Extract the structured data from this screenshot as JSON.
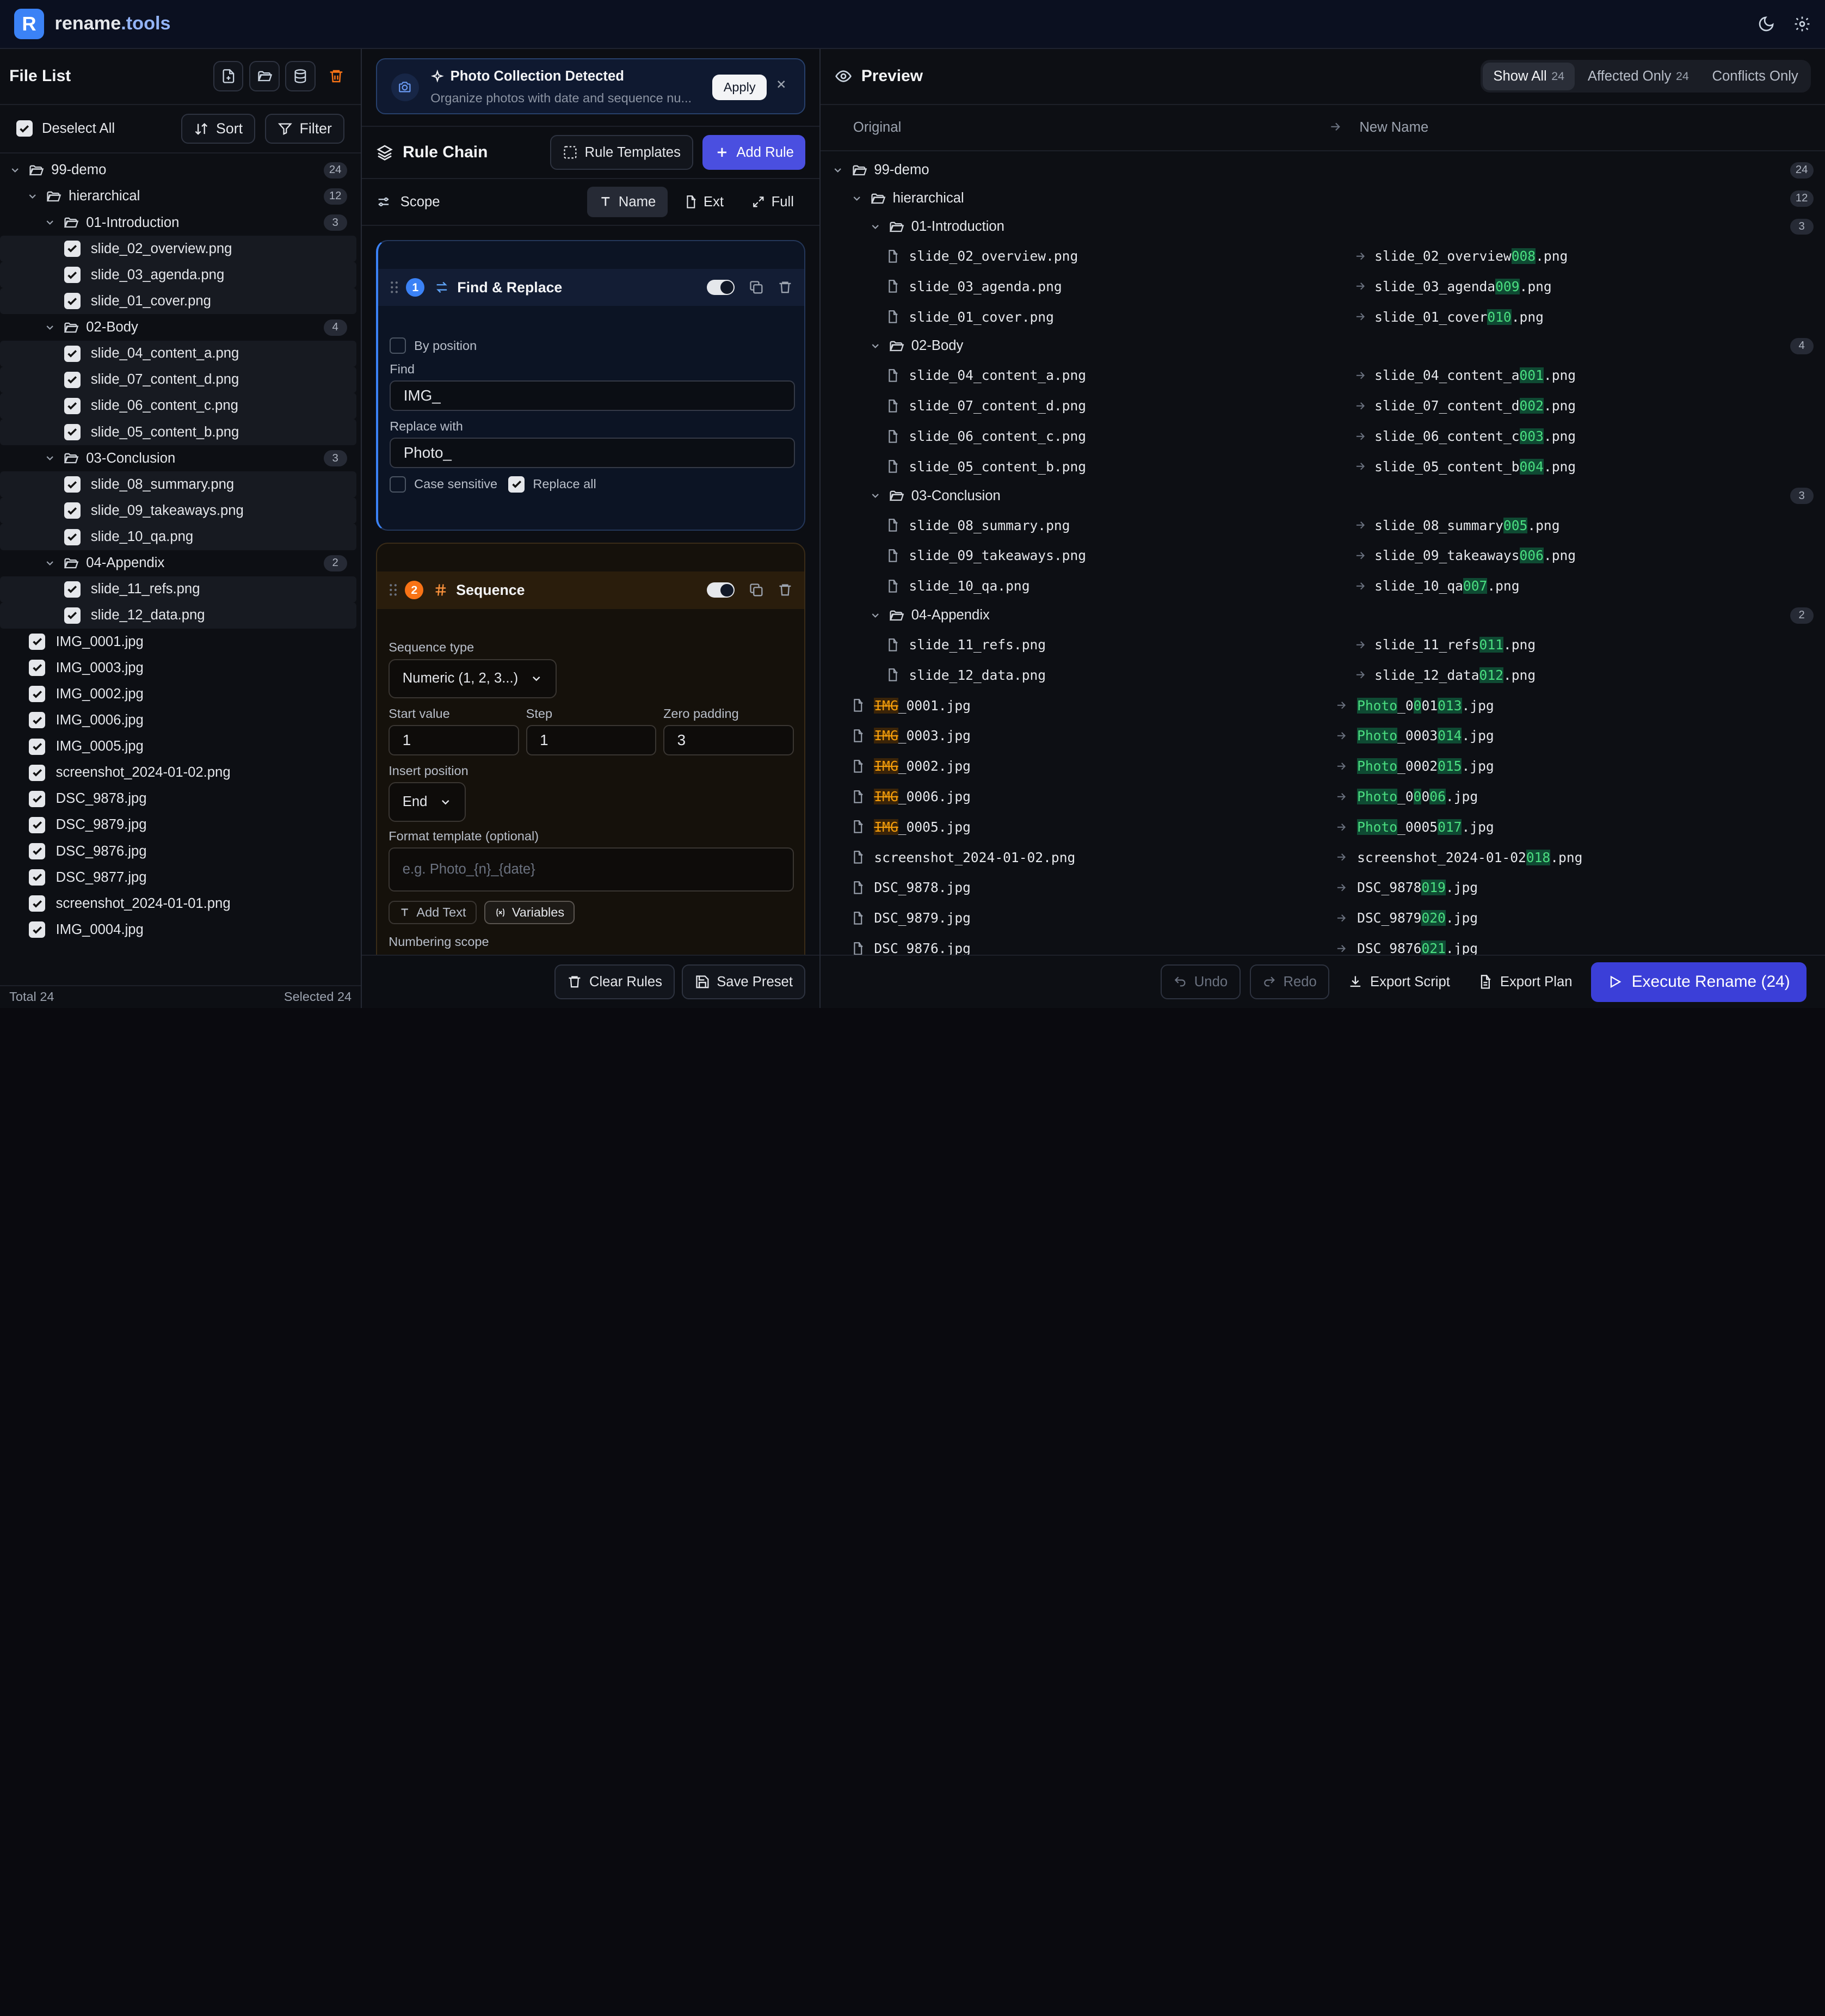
{
  "app": {
    "name": "rename",
    "tld": ".tools",
    "logo_letter": "R"
  },
  "colors": {
    "accent": "#4a4fe0",
    "highlight_add": "#4ade80",
    "highlight_remove": "#f59e0b",
    "danger": "#f97316"
  },
  "file_list": {
    "title": "File List",
    "deselect_label": "Deselect All",
    "sort_label": "Sort",
    "filter_label": "Filter",
    "footer_total": "Total 24",
    "footer_selected": "Selected 24",
    "tree": [
      {
        "kind": "dir",
        "depth": 0,
        "name": "99-demo",
        "count": "24"
      },
      {
        "kind": "dir",
        "depth": 1,
        "name": "hierarchical",
        "count": "12"
      },
      {
        "kind": "dir",
        "depth": 2,
        "name": "01-Introduction",
        "count": "3"
      },
      {
        "kind": "file",
        "depth": 3,
        "name": "slide_02_overview.png"
      },
      {
        "kind": "file",
        "depth": 3,
        "name": "slide_03_agenda.png"
      },
      {
        "kind": "file",
        "depth": 3,
        "name": "slide_01_cover.png"
      },
      {
        "kind": "dir",
        "depth": 2,
        "name": "02-Body",
        "count": "4"
      },
      {
        "kind": "file",
        "depth": 3,
        "name": "slide_04_content_a.png"
      },
      {
        "kind": "file",
        "depth": 3,
        "name": "slide_07_content_d.png"
      },
      {
        "kind": "file",
        "depth": 3,
        "name": "slide_06_content_c.png"
      },
      {
        "kind": "file",
        "depth": 3,
        "name": "slide_05_content_b.png"
      },
      {
        "kind": "dir",
        "depth": 2,
        "name": "03-Conclusion",
        "count": "3"
      },
      {
        "kind": "file",
        "depth": 3,
        "name": "slide_08_summary.png"
      },
      {
        "kind": "file",
        "depth": 3,
        "name": "slide_09_takeaways.png"
      },
      {
        "kind": "file",
        "depth": 3,
        "name": "slide_10_qa.png"
      },
      {
        "kind": "dir",
        "depth": 2,
        "name": "04-Appendix",
        "count": "2"
      },
      {
        "kind": "file",
        "depth": 3,
        "name": "slide_11_refs.png"
      },
      {
        "kind": "file",
        "depth": 3,
        "name": "slide_12_data.png"
      },
      {
        "kind": "file",
        "depth": 1,
        "name": "IMG_0001.jpg"
      },
      {
        "kind": "file",
        "depth": 1,
        "name": "IMG_0003.jpg"
      },
      {
        "kind": "file",
        "depth": 1,
        "name": "IMG_0002.jpg"
      },
      {
        "kind": "file",
        "depth": 1,
        "name": "IMG_0006.jpg"
      },
      {
        "kind": "file",
        "depth": 1,
        "name": "IMG_0005.jpg"
      },
      {
        "kind": "file",
        "depth": 1,
        "name": "screenshot_2024-01-02.png"
      },
      {
        "kind": "file",
        "depth": 1,
        "name": "DSC_9878.jpg"
      },
      {
        "kind": "file",
        "depth": 1,
        "name": "DSC_9879.jpg"
      },
      {
        "kind": "file",
        "depth": 1,
        "name": "DSC_9876.jpg"
      },
      {
        "kind": "file",
        "depth": 1,
        "name": "DSC_9877.jpg"
      },
      {
        "kind": "file",
        "depth": 1,
        "name": "screenshot_2024-01-01.png"
      },
      {
        "kind": "file",
        "depth": 1,
        "name": "IMG_0004.jpg"
      }
    ]
  },
  "banner": {
    "title": "Photo Collection Detected",
    "description": "Organize photos with date and sequence nu...",
    "apply_label": "Apply"
  },
  "rule_chain": {
    "title": "Rule Chain",
    "templates_label": "Rule Templates",
    "add_label": "Add Rule",
    "scope_label": "Scope",
    "scope_options": [
      "Name",
      "Ext",
      "Full"
    ],
    "rule1": {
      "number": "1",
      "name": "Find & Replace",
      "by_position_label": "By position",
      "find_label": "Find",
      "find_value": "IMG_",
      "replace_label": "Replace with",
      "replace_value": "Photo_",
      "case_label": "Case sensitive",
      "replace_all_label": "Replace all"
    },
    "rule2": {
      "number": "2",
      "name": "Sequence",
      "seq_type_label": "Sequence type",
      "seq_type_value": "Numeric (1, 2, 3...)",
      "start_label": "Start value",
      "start_value": "1",
      "step_label": "Step",
      "step_value": "1",
      "pad_label": "Zero padding",
      "pad_value": "3",
      "insert_label": "Insert position",
      "insert_value": "End",
      "format_label": "Format template (optional)",
      "format_placeholder": "e.g. Photo_{n}_{date}",
      "add_text_label": "Add Text",
      "variables_label": "Variables",
      "numbering_label": "Numbering scope"
    },
    "clear_label": "Clear Rules",
    "save_label": "Save Preset"
  },
  "preview": {
    "title": "Preview",
    "tabs": [
      {
        "label": "Show All",
        "count": "24"
      },
      {
        "label": "Affected Only",
        "count": "24"
      },
      {
        "label": "Conflicts Only",
        "count": ""
      }
    ],
    "col_original": "Original",
    "col_new": "New Name",
    "undo_label": "Undo",
    "redo_label": "Redo",
    "export_script_label": "Export Script",
    "export_plan_label": "Export Plan",
    "execute_label": "Execute Rename (24)",
    "rows": [
      {
        "kind": "dir",
        "depth": 0,
        "name": "99-demo",
        "count": "24"
      },
      {
        "kind": "dir",
        "depth": 1,
        "name": "hierarchical",
        "count": "12"
      },
      {
        "kind": "dir",
        "depth": 2,
        "name": "01-Introduction",
        "count": "3"
      },
      {
        "kind": "file",
        "depth": 3,
        "orig": [
          [
            "slide_02_overview.png",
            ""
          ]
        ],
        "new": [
          [
            "slide_02_overview",
            ""
          ],
          [
            "008",
            "a"
          ],
          [
            ".png",
            ""
          ]
        ]
      },
      {
        "kind": "file",
        "depth": 3,
        "orig": [
          [
            "slide_03_agenda.png",
            ""
          ]
        ],
        "new": [
          [
            "slide_03_agenda",
            ""
          ],
          [
            "009",
            "a"
          ],
          [
            ".png",
            ""
          ]
        ]
      },
      {
        "kind": "file",
        "depth": 3,
        "orig": [
          [
            "slide_01_cover.png",
            ""
          ]
        ],
        "new": [
          [
            "slide_01_cover",
            ""
          ],
          [
            "010",
            "a"
          ],
          [
            ".png",
            ""
          ]
        ]
      },
      {
        "kind": "dir",
        "depth": 2,
        "name": "02-Body",
        "count": "4"
      },
      {
        "kind": "file",
        "depth": 3,
        "orig": [
          [
            "slide_04_content_a.png",
            ""
          ]
        ],
        "new": [
          [
            "slide_04_content_a",
            ""
          ],
          [
            "001",
            "a"
          ],
          [
            ".png",
            ""
          ]
        ]
      },
      {
        "kind": "file",
        "depth": 3,
        "orig": [
          [
            "slide_07_content_d.png",
            ""
          ]
        ],
        "new": [
          [
            "slide_07_content_d",
            ""
          ],
          [
            "002",
            "a"
          ],
          [
            ".png",
            ""
          ]
        ]
      },
      {
        "kind": "file",
        "depth": 3,
        "orig": [
          [
            "slide_06_content_c.png",
            ""
          ]
        ],
        "new": [
          [
            "slide_06_content_c",
            ""
          ],
          [
            "003",
            "a"
          ],
          [
            ".png",
            ""
          ]
        ]
      },
      {
        "kind": "file",
        "depth": 3,
        "orig": [
          [
            "slide_05_content_b.png",
            ""
          ]
        ],
        "new": [
          [
            "slide_05_content_b",
            ""
          ],
          [
            "004",
            "a"
          ],
          [
            ".png",
            ""
          ]
        ]
      },
      {
        "kind": "dir",
        "depth": 2,
        "name": "03-Conclusion",
        "count": "3"
      },
      {
        "kind": "file",
        "depth": 3,
        "orig": [
          [
            "slide_08_summary.png",
            ""
          ]
        ],
        "new": [
          [
            "slide_08_summary",
            ""
          ],
          [
            "005",
            "a"
          ],
          [
            ".png",
            ""
          ]
        ]
      },
      {
        "kind": "file",
        "depth": 3,
        "orig": [
          [
            "slide_09_takeaways.png",
            ""
          ]
        ],
        "new": [
          [
            "slide_09_takeaways",
            ""
          ],
          [
            "006",
            "a"
          ],
          [
            ".png",
            ""
          ]
        ]
      },
      {
        "kind": "file",
        "depth": 3,
        "orig": [
          [
            "slide_10_qa.png",
            ""
          ]
        ],
        "new": [
          [
            "slide_10_qa",
            ""
          ],
          [
            "007",
            "a"
          ],
          [
            ".png",
            ""
          ]
        ]
      },
      {
        "kind": "dir",
        "depth": 2,
        "name": "04-Appendix",
        "count": "2"
      },
      {
        "kind": "file",
        "depth": 3,
        "orig": [
          [
            "slide_11_refs.png",
            ""
          ]
        ],
        "new": [
          [
            "slide_11_refs",
            ""
          ],
          [
            "011",
            "a"
          ],
          [
            ".png",
            ""
          ]
        ]
      },
      {
        "kind": "file",
        "depth": 3,
        "orig": [
          [
            "slide_12_data.png",
            ""
          ]
        ],
        "new": [
          [
            "slide_12_data",
            ""
          ],
          [
            "012",
            "a"
          ],
          [
            ".png",
            ""
          ]
        ]
      },
      {
        "kind": "file",
        "depth": 1,
        "orig": [
          [
            "IMG",
            "d"
          ],
          [
            "_0001.jpg",
            ""
          ]
        ],
        "new": [
          [
            "Photo",
            "a"
          ],
          [
            "_0",
            ""
          ],
          [
            "0",
            "a"
          ],
          [
            "01",
            ""
          ],
          [
            "01",
            "a"
          ],
          [
            "3",
            "a"
          ],
          [
            ".jpg",
            ""
          ]
        ]
      },
      {
        "kind": "file",
        "depth": 1,
        "orig": [
          [
            "IMG",
            "d"
          ],
          [
            "_0003.jpg",
            ""
          ]
        ],
        "new": [
          [
            "Photo",
            "a"
          ],
          [
            "_0003",
            ""
          ],
          [
            "014",
            "a"
          ],
          [
            ".jpg",
            ""
          ]
        ]
      },
      {
        "kind": "file",
        "depth": 1,
        "orig": [
          [
            "IMG",
            "d"
          ],
          [
            "_0002.jpg",
            ""
          ]
        ],
        "new": [
          [
            "Photo",
            "a"
          ],
          [
            "_0002",
            ""
          ],
          [
            "015",
            "a"
          ],
          [
            ".jpg",
            ""
          ]
        ]
      },
      {
        "kind": "file",
        "depth": 1,
        "orig": [
          [
            "IMG",
            "d"
          ],
          [
            "_0006.jpg",
            ""
          ]
        ],
        "new": [
          [
            "Photo",
            "a"
          ],
          [
            "_0",
            ""
          ],
          [
            "0",
            "a"
          ],
          [
            "0",
            ""
          ],
          [
            "0",
            "a"
          ],
          [
            "6",
            "a"
          ],
          [
            ".jpg",
            ""
          ]
        ]
      },
      {
        "kind": "file",
        "depth": 1,
        "orig": [
          [
            "IMG",
            "d"
          ],
          [
            "_0005.jpg",
            ""
          ]
        ],
        "new": [
          [
            "Photo",
            "a"
          ],
          [
            "_0005",
            ""
          ],
          [
            "017",
            "a"
          ],
          [
            ".jpg",
            ""
          ]
        ]
      },
      {
        "kind": "file",
        "depth": 1,
        "orig": [
          [
            "screenshot_2024-01-02.png",
            ""
          ]
        ],
        "new": [
          [
            "screenshot_2024-01-02",
            ""
          ],
          [
            "018",
            "a"
          ],
          [
            ".png",
            ""
          ]
        ]
      },
      {
        "kind": "file",
        "depth": 1,
        "orig": [
          [
            "DSC_9878.jpg",
            ""
          ]
        ],
        "new": [
          [
            "DSC_9878",
            ""
          ],
          [
            "019",
            "a"
          ],
          [
            ".jpg",
            ""
          ]
        ]
      },
      {
        "kind": "file",
        "depth": 1,
        "orig": [
          [
            "DSC_9879.jpg",
            ""
          ]
        ],
        "new": [
          [
            "DSC_9879",
            ""
          ],
          [
            "020",
            "a"
          ],
          [
            ".jpg",
            ""
          ]
        ]
      },
      {
        "kind": "file",
        "depth": 1,
        "orig": [
          [
            "DSC_9876.jpg",
            ""
          ]
        ],
        "new": [
          [
            "DSC_9876",
            ""
          ],
          [
            "021",
            "a"
          ],
          [
            ".jpg",
            ""
          ]
        ]
      }
    ]
  }
}
